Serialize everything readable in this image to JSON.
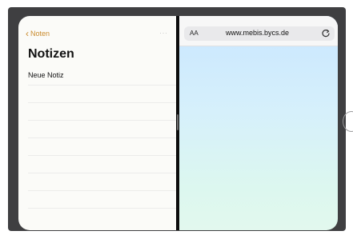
{
  "notes": {
    "back_label": "Noten",
    "back_chevron": "‹",
    "more_label": "···",
    "title": "Notizen",
    "items": [
      {
        "label": "Neue Notiz"
      },
      {
        "label": ""
      },
      {
        "label": ""
      },
      {
        "label": ""
      },
      {
        "label": ""
      },
      {
        "label": ""
      },
      {
        "label": ""
      },
      {
        "label": ""
      }
    ]
  },
  "safari": {
    "aa_label": "AA",
    "url": "www.mebis.bycs.de",
    "reload_icon": "reload-icon"
  },
  "colors": {
    "accent": "#c98a2b",
    "bezel": "#3f3f41",
    "divider": "#0d0d0d"
  }
}
